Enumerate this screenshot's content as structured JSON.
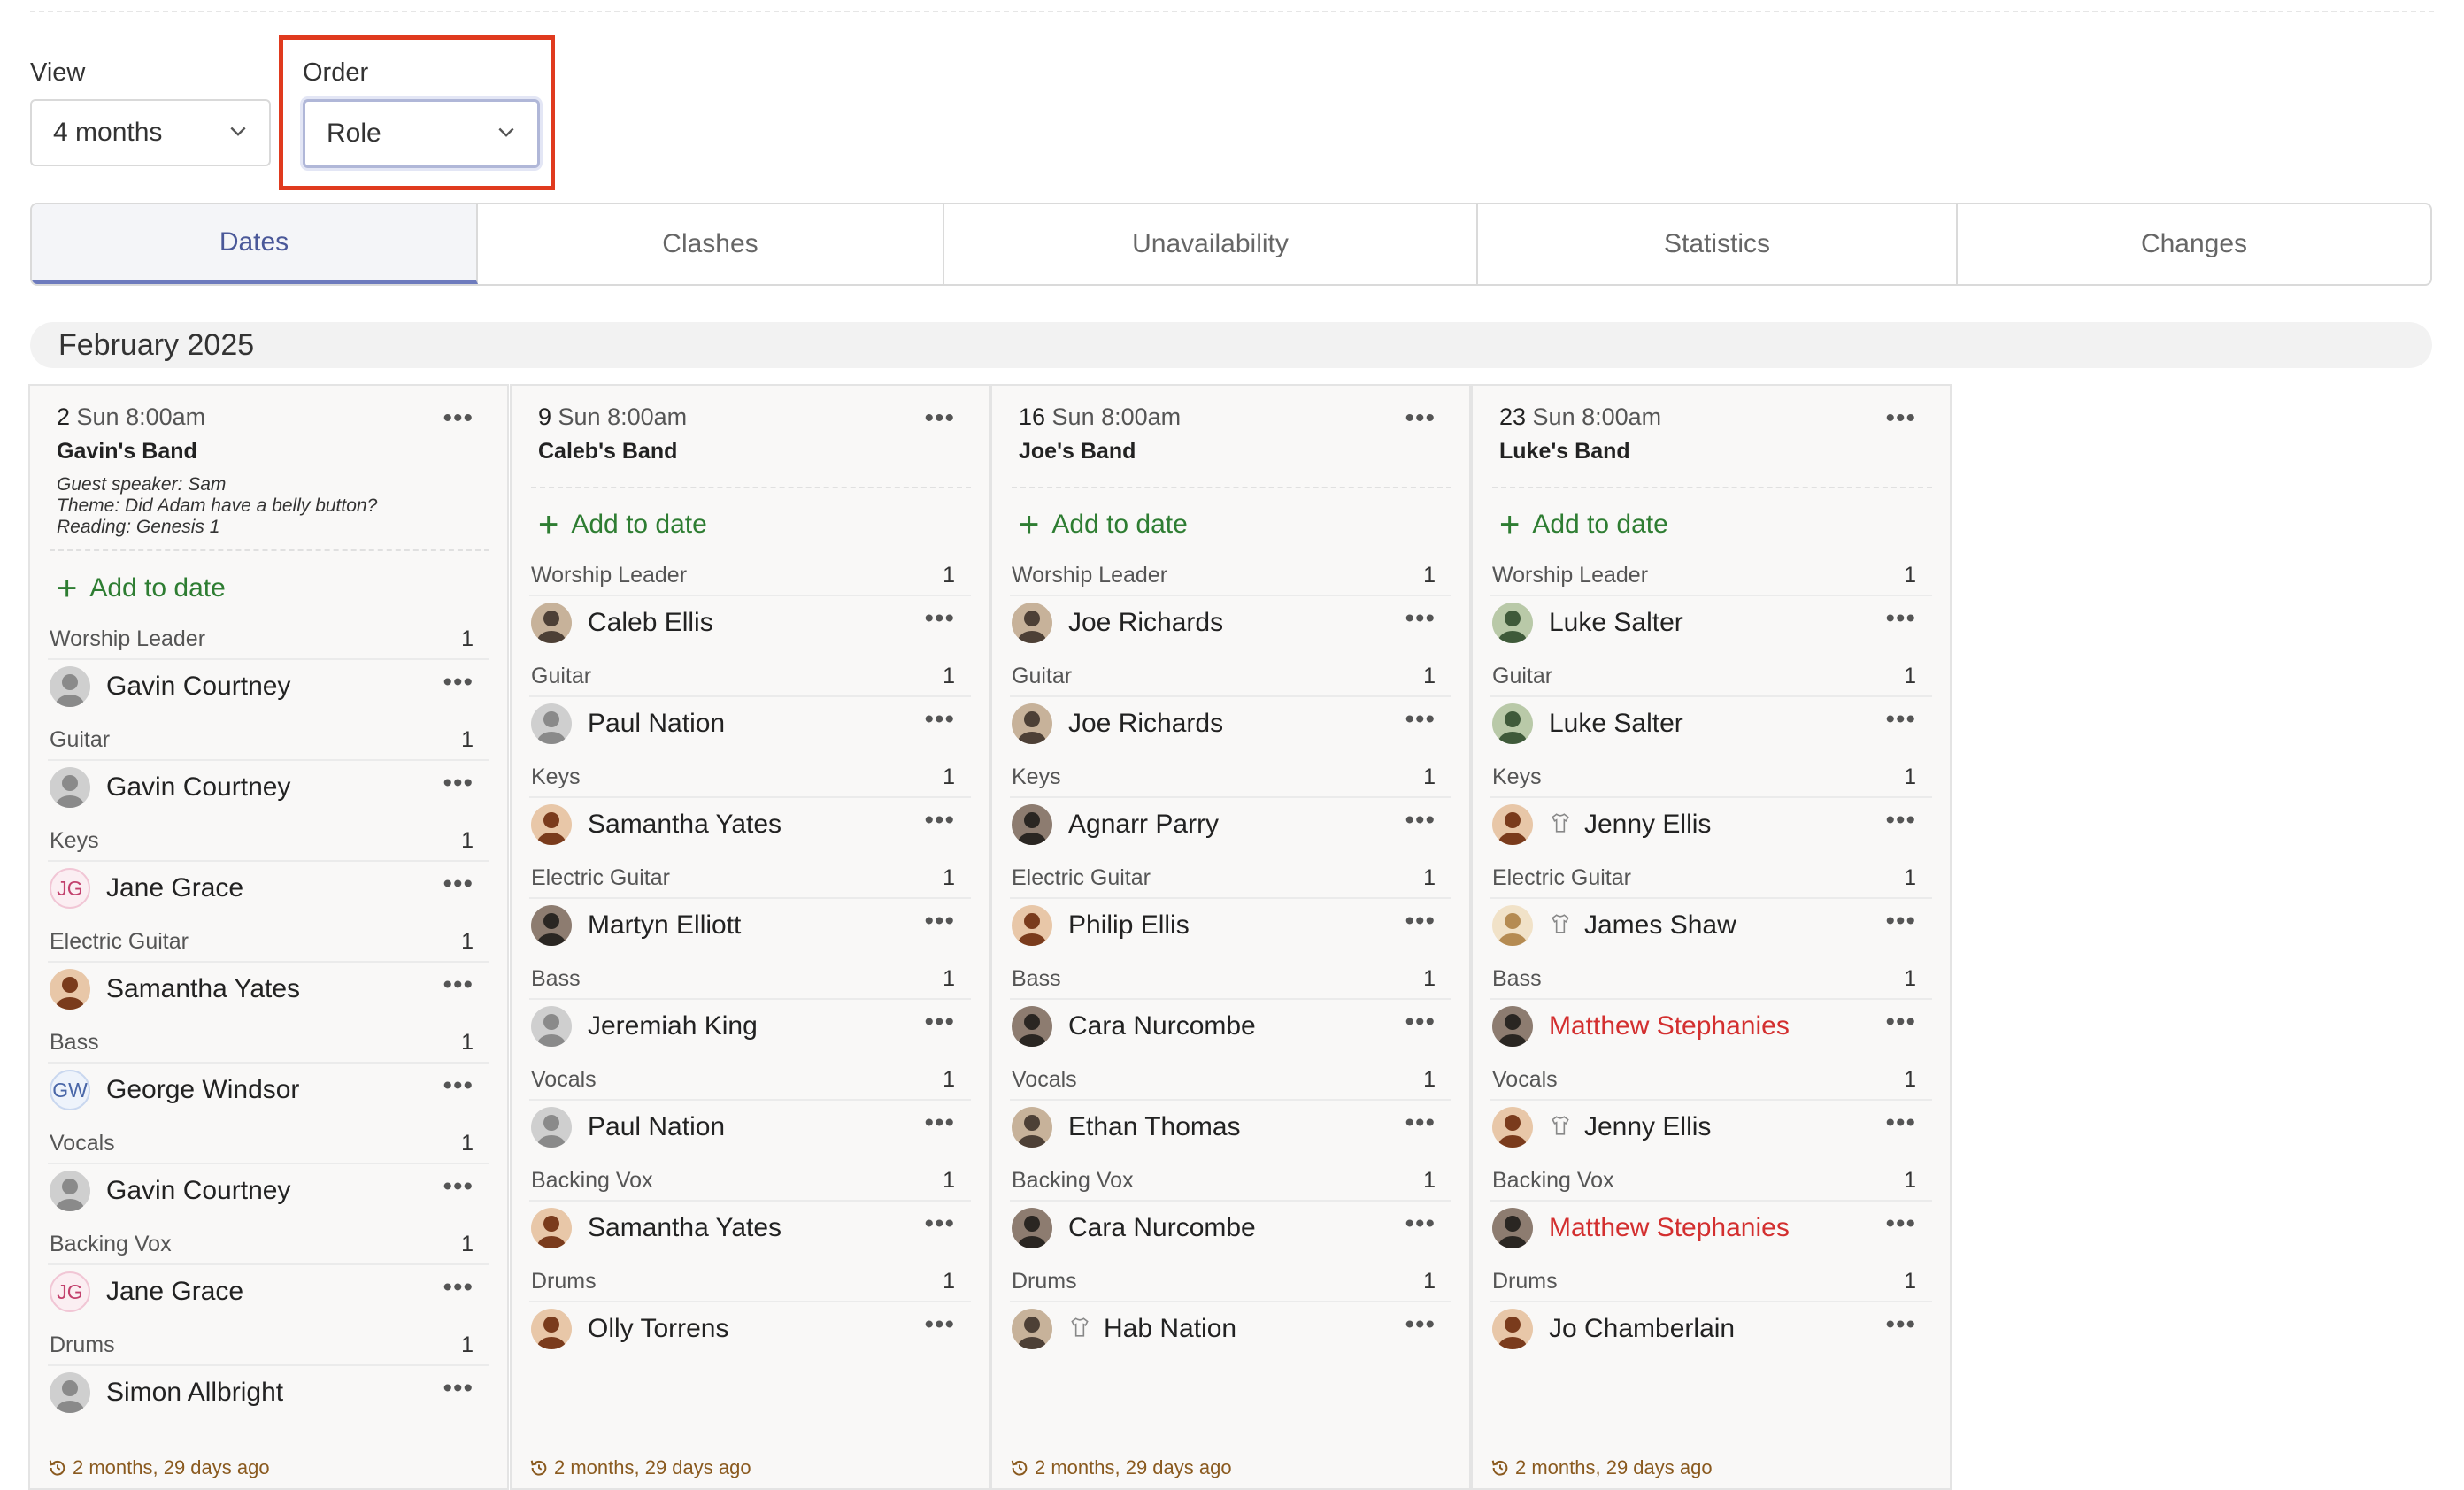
{
  "filters": {
    "view": {
      "label": "View",
      "value": "4 months"
    },
    "order": {
      "label": "Order",
      "value": "Role"
    }
  },
  "tabs": [
    {
      "label": "Dates",
      "active": true
    },
    {
      "label": "Clashes",
      "active": false
    },
    {
      "label": "Unavailability",
      "active": false
    },
    {
      "label": "Statistics",
      "active": false
    },
    {
      "label": "Changes",
      "active": false
    }
  ],
  "month": "February 2025",
  "colors": {
    "add": "#2e7d32",
    "conflict": "#d32f2f",
    "accent": "#6d7bbd",
    "highlight": "#e03a1e"
  },
  "add_label": "Add to date",
  "columns": [
    {
      "day": "2",
      "when": "Sun 8:00am",
      "title": "Gavin's Band",
      "notes": [
        "Guest speaker: Sam",
        "Theme: Did Adam have a belly button?",
        "Reading: Genesis 1"
      ],
      "updated": "2 months, 29 days ago",
      "roles": [
        {
          "role": "Worship Leader",
          "count": "1",
          "person": "Gavin Courtney",
          "avatar": "photo-grey"
        },
        {
          "role": "Guitar",
          "count": "1",
          "person": "Gavin Courtney",
          "avatar": "photo-grey"
        },
        {
          "role": "Keys",
          "count": "1",
          "person": "Jane Grace",
          "avatar": "initials",
          "initials": "JG"
        },
        {
          "role": "Electric Guitar",
          "count": "1",
          "person": "Samantha Yates",
          "avatar": "photo-warm"
        },
        {
          "role": "Bass",
          "count": "1",
          "person": "George Windsor",
          "avatar": "initials",
          "initials": "GW"
        },
        {
          "role": "Vocals",
          "count": "1",
          "person": "Gavin Courtney",
          "avatar": "photo-grey"
        },
        {
          "role": "Backing Vox",
          "count": "1",
          "person": "Jane Grace",
          "avatar": "initials",
          "initials": "JG"
        },
        {
          "role": "Drums",
          "count": "1",
          "person": "Simon Allbright",
          "avatar": "photo-grey"
        }
      ]
    },
    {
      "day": "9",
      "when": "Sun 8:00am",
      "title": "Caleb's Band",
      "notes": [],
      "updated": "2 months, 29 days ago",
      "roles": [
        {
          "role": "Worship Leader",
          "count": "1",
          "person": "Caleb Ellis",
          "avatar": "photo-mid"
        },
        {
          "role": "Guitar",
          "count": "1",
          "person": "Paul Nation",
          "avatar": "photo-grey"
        },
        {
          "role": "Keys",
          "count": "1",
          "person": "Samantha Yates",
          "avatar": "photo-warm"
        },
        {
          "role": "Electric Guitar",
          "count": "1",
          "person": "Martyn Elliott",
          "avatar": "photo-dark"
        },
        {
          "role": "Bass",
          "count": "1",
          "person": "Jeremiah King",
          "avatar": "photo-grey"
        },
        {
          "role": "Vocals",
          "count": "1",
          "person": "Paul Nation",
          "avatar": "photo-grey"
        },
        {
          "role": "Backing Vox",
          "count": "1",
          "person": "Samantha Yates",
          "avatar": "photo-warm"
        },
        {
          "role": "Drums",
          "count": "1",
          "person": "Olly Torrens",
          "avatar": "photo-warm"
        }
      ]
    },
    {
      "day": "16",
      "when": "Sun 8:00am",
      "title": "Joe's Band",
      "notes": [],
      "updated": "2 months, 29 days ago",
      "roles": [
        {
          "role": "Worship Leader",
          "count": "1",
          "person": "Joe Richards",
          "avatar": "photo-mid"
        },
        {
          "role": "Guitar",
          "count": "1",
          "person": "Joe Richards",
          "avatar": "photo-mid"
        },
        {
          "role": "Keys",
          "count": "1",
          "person": "Agnarr Parry",
          "avatar": "photo-dark"
        },
        {
          "role": "Electric Guitar",
          "count": "1",
          "person": "Philip Ellis",
          "avatar": "photo-warm"
        },
        {
          "role": "Bass",
          "count": "1",
          "person": "Cara Nurcombe",
          "avatar": "photo-dark"
        },
        {
          "role": "Vocals",
          "count": "1",
          "person": "Ethan Thomas",
          "avatar": "photo-mid"
        },
        {
          "role": "Backing Vox",
          "count": "1",
          "person": "Cara Nurcombe",
          "avatar": "photo-dark"
        },
        {
          "role": "Drums",
          "count": "1",
          "person": "Hab Nation",
          "avatar": "photo-mid",
          "tshirt": true
        }
      ]
    },
    {
      "day": "23",
      "when": "Sun 8:00am",
      "title": "Luke's Band",
      "notes": [],
      "updated": "2 months, 29 days ago",
      "roles": [
        {
          "role": "Worship Leader",
          "count": "1",
          "person": "Luke Salter",
          "avatar": "photo-green"
        },
        {
          "role": "Guitar",
          "count": "1",
          "person": "Luke Salter",
          "avatar": "photo-green"
        },
        {
          "role": "Keys",
          "count": "1",
          "person": "Jenny Ellis",
          "avatar": "photo-warm",
          "tshirt": true
        },
        {
          "role": "Electric Guitar",
          "count": "1",
          "person": "James Shaw",
          "avatar": "photo-light",
          "tshirt": true
        },
        {
          "role": "Bass",
          "count": "1",
          "person": "Matthew Stephanies",
          "avatar": "photo-dark",
          "conflict": true
        },
        {
          "role": "Vocals",
          "count": "1",
          "person": "Jenny Ellis",
          "avatar": "photo-warm",
          "tshirt": true
        },
        {
          "role": "Backing Vox",
          "count": "1",
          "person": "Matthew Stephanies",
          "avatar": "photo-dark",
          "conflict": true
        },
        {
          "role": "Drums",
          "count": "1",
          "person": "Jo Chamberlain",
          "avatar": "photo-warm"
        }
      ]
    }
  ]
}
